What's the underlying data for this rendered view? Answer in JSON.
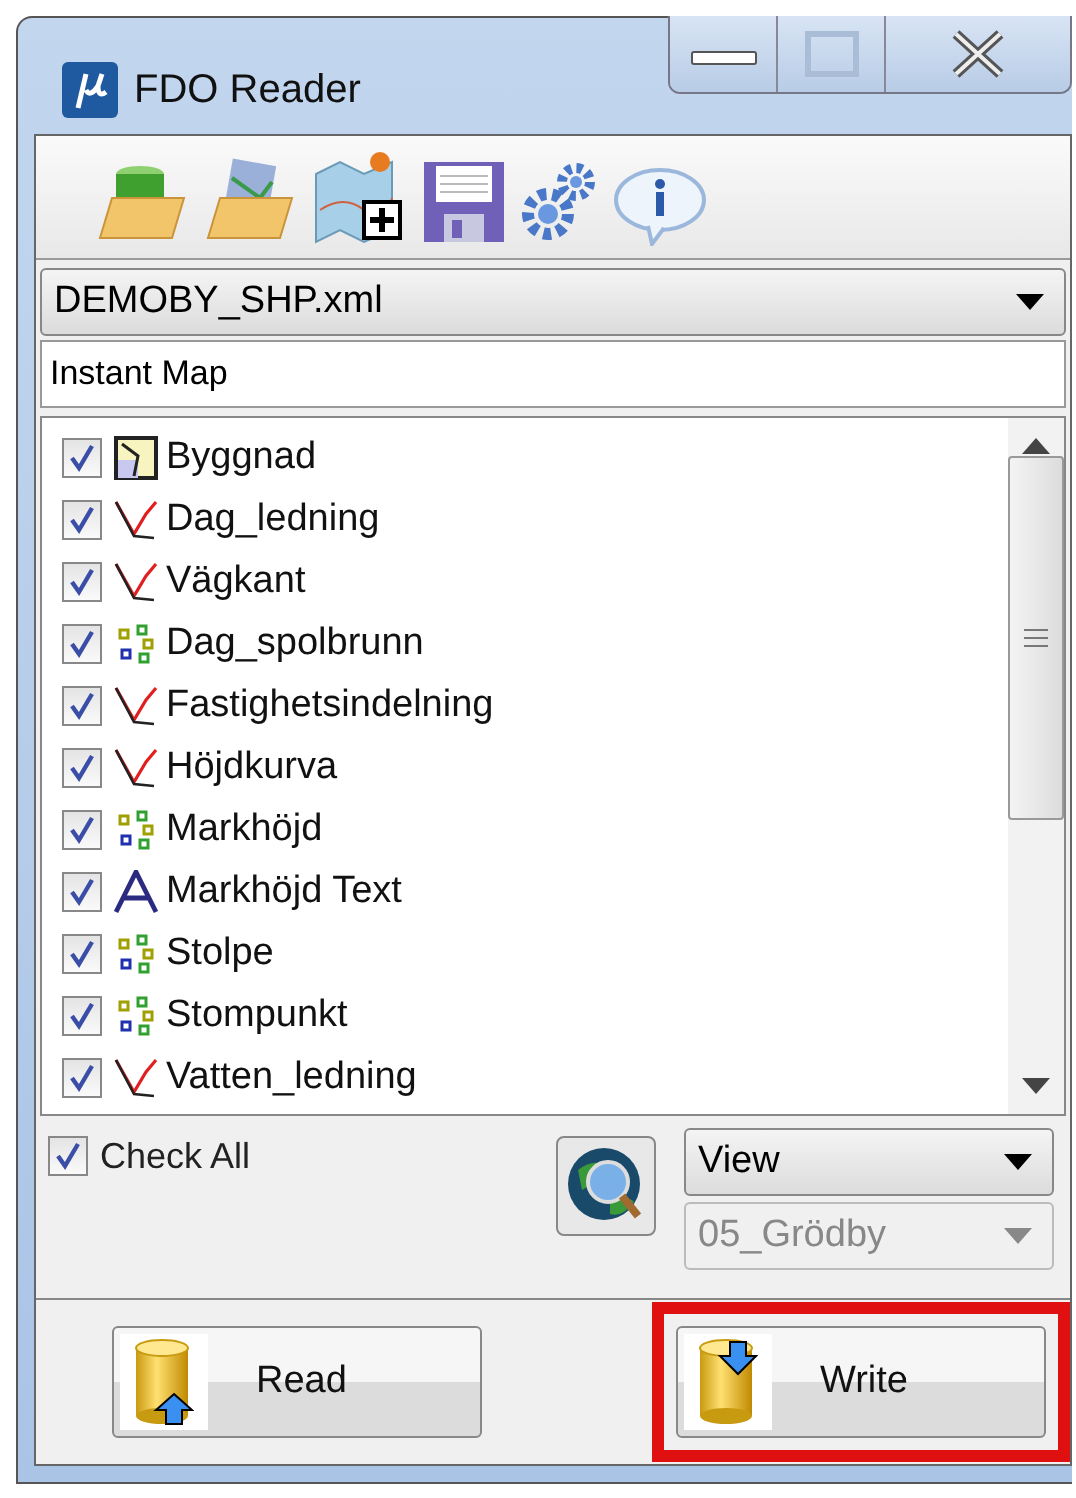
{
  "window": {
    "title": "FDO Reader"
  },
  "source": {
    "value": "DEMOBY_SHP.xml"
  },
  "map_name": {
    "value": "Instant Map"
  },
  "layers": [
    {
      "name": "Byggnad",
      "kind": "polygon",
      "checked": true
    },
    {
      "name": "Dag_ledning",
      "kind": "line",
      "checked": true
    },
    {
      "name": "Vägkant",
      "kind": "line",
      "checked": true
    },
    {
      "name": "Dag_spolbrunn",
      "kind": "point",
      "checked": true
    },
    {
      "name": "Fastighetsindelning",
      "kind": "line",
      "checked": true
    },
    {
      "name": "Höjdkurva",
      "kind": "line",
      "checked": true
    },
    {
      "name": "Markhöjd",
      "kind": "point",
      "checked": true
    },
    {
      "name": "Markhöjd Text",
      "kind": "text",
      "checked": true
    },
    {
      "name": "Stolpe",
      "kind": "point",
      "checked": true
    },
    {
      "name": "Stompunkt",
      "kind": "point",
      "checked": true
    },
    {
      "name": "Vatten_ledning",
      "kind": "line",
      "checked": true
    }
  ],
  "check_all": {
    "label": "Check All",
    "checked": true
  },
  "view_select": {
    "value": "View",
    "disabled": false
  },
  "model_select": {
    "value": "05_Grödby",
    "disabled": true
  },
  "buttons": [
    {
      "label": "Read",
      "kind": "read",
      "highlighted": false
    },
    {
      "label": "Write",
      "kind": "write",
      "highlighted": true
    }
  ]
}
